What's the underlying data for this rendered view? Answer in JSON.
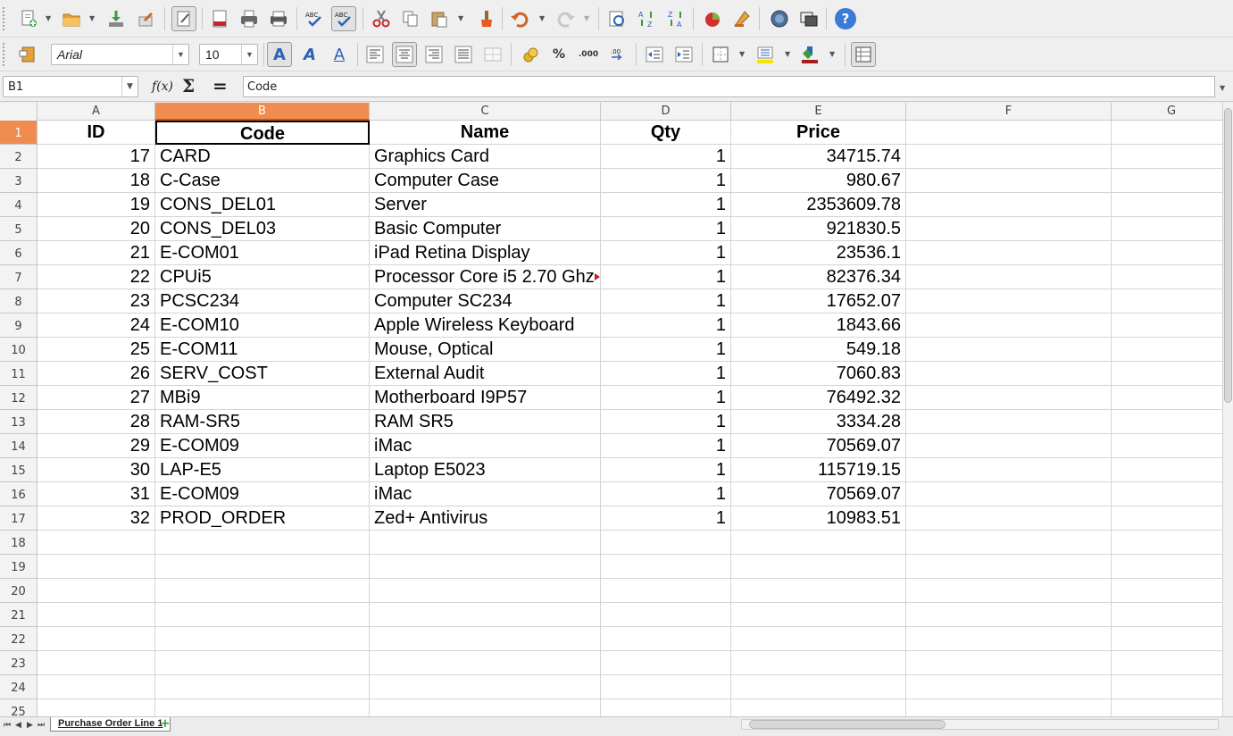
{
  "toolbar1": {
    "icons": [
      "new-icon",
      "open-icon",
      "save-icon",
      "edit-file-icon",
      "export-pdf-icon",
      "print-icon",
      "print-preview-icon",
      "spellcheck-icon",
      "autospellcheck-icon",
      "cut-icon",
      "copy-icon",
      "paste-icon",
      "clone-formatting-icon",
      "undo-icon",
      "redo-icon",
      "navigator-icon",
      "sort-ascending-icon",
      "sort-descending-icon",
      "chart-icon",
      "draw-functions-icon",
      "gallery-icon",
      "data-sources-icon",
      "help-icon"
    ],
    "help_label": "?"
  },
  "toolbar2": {
    "font_name": "Arial",
    "font_size": "10",
    "bold_label": "A",
    "italic_label": "A",
    "underline_label": "A",
    "percent_label": "%",
    "decimal_label": ".000"
  },
  "formula_bar": {
    "name_box": "B1",
    "content": "Code",
    "fx_label": "f(x)",
    "sum_label": "Σ",
    "equals_label": "="
  },
  "columns": [
    "A",
    "B",
    "C",
    "D",
    "E",
    "F",
    "G"
  ],
  "selected_column": "B",
  "row_numbers": [
    "1",
    "2",
    "3",
    "4",
    "5",
    "6",
    "7",
    "8",
    "9",
    "10",
    "11",
    "12",
    "13",
    "14",
    "15",
    "16",
    "17",
    "18",
    "19",
    "20",
    "21",
    "22",
    "23",
    "24",
    "25"
  ],
  "selected_row": "1",
  "table": {
    "headers": [
      "ID",
      "Code",
      "Name",
      "Qty",
      "Price"
    ],
    "rows": [
      [
        "17",
        "CARD",
        "Graphics Card",
        "1",
        "34715.74"
      ],
      [
        "18",
        "C-Case",
        "Computer Case",
        "1",
        "980.67"
      ],
      [
        "19",
        "CONS_DEL01",
        "Server",
        "1",
        "2353609.78"
      ],
      [
        "20",
        "CONS_DEL03",
        "Basic Computer",
        "1",
        "921830.5"
      ],
      [
        "21",
        "E-COM01",
        "iPad Retina Display",
        "1",
        "23536.1"
      ],
      [
        "22",
        "CPUi5",
        "Processor Core i5 2.70 Ghz",
        "1",
        "82376.34"
      ],
      [
        "23",
        "PCSC234",
        "Computer SC234",
        "1",
        "17652.07"
      ],
      [
        "24",
        "E-COM10",
        "Apple Wireless Keyboard",
        "1",
        "1843.66"
      ],
      [
        "25",
        "E-COM11",
        "Mouse, Optical",
        "1",
        "549.18"
      ],
      [
        "26",
        "SERV_COST",
        "External Audit",
        "1",
        "7060.83"
      ],
      [
        "27",
        "MBi9",
        "Motherboard I9P57",
        "1",
        "76492.32"
      ],
      [
        "28",
        "RAM-SR5",
        "RAM SR5",
        "1",
        "3334.28"
      ],
      [
        "29",
        "E-COM09",
        "iMac",
        "1",
        "70569.07"
      ],
      [
        "30",
        "LAP-E5",
        "Laptop E5023",
        "1",
        "115719.15"
      ],
      [
        "31",
        "E-COM09",
        "iMac",
        "1",
        "70569.07"
      ],
      [
        "32",
        "PROD_ORDER",
        "Zed+ Antivirus",
        "1",
        "10983.51"
      ]
    ]
  },
  "sheet_tabs": [
    "Purchase Order Line 1"
  ],
  "colors": {
    "selection": "#f08c50",
    "accent": "#d0541c",
    "help": "#3a7bd5"
  }
}
